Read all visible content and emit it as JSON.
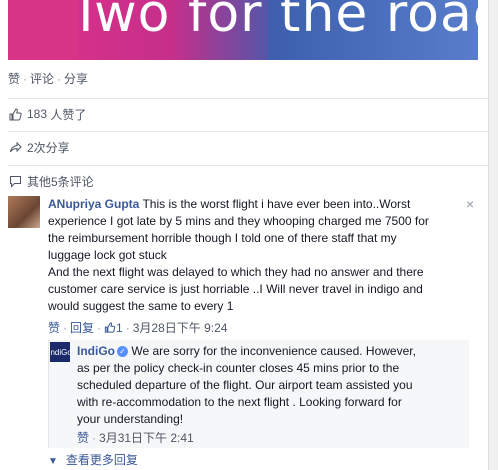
{
  "banner": {
    "caption": "Two for the road"
  },
  "actions": {
    "like": "赞",
    "comment": "评论",
    "share": "分享"
  },
  "stats": {
    "likes_count": "183",
    "likes_text": "人赞了",
    "shares_text": "2次分享",
    "more_comments_text": "其他5条评论"
  },
  "comment": {
    "author": "ANupriya Gupta",
    "lines": [
      "This is the worst flight i have ever been into..Worst",
      "experience I got late by 5 mins and they whooping charged me 7500 for",
      "the reimbursement horrible though I told one of there staff that my",
      "luggage lock got stuck",
      "And the next flight was delayed to which they had no answer and there",
      "customer care service is just horriable ..I Will never travel in indigo and",
      "would suggest the same to every 1"
    ],
    "like_label": "赞",
    "reply_label": "回复",
    "like_count": "1",
    "timestamp": "3月28日下午 9:24",
    "close_icon_char": "×"
  },
  "reply": {
    "author": "IndiGo",
    "avatar_text": "IndiGo",
    "verified_char": "✓",
    "lines": [
      "We are sorry for the inconvenience caused. However,",
      "as per the policy check-in counter closes 45 mins prior to the",
      "scheduled departure of the flight. Our airport team assisted you",
      "with re-accommodation to the next flight . Looking forward for",
      "your understanding!"
    ],
    "like_label": "赞",
    "timestamp": "3月31日下午 2:41"
  },
  "more_replies": {
    "arrow_char": "▼",
    "label": "查看更多回复"
  },
  "colors": {
    "link": "#3b5998",
    "meta": "#4e5665",
    "reply_bg": "#f6f7f9"
  }
}
